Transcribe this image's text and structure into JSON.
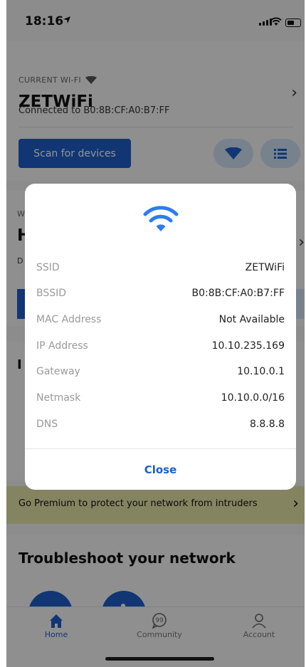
{
  "status_bar": {
    "time": "18:16"
  },
  "current_wifi": {
    "section_label": "CURRENT WI-FI",
    "network_name": "ZETWiFi",
    "connected_text": "Connected to B0:8B:CF:A0:B7:FF",
    "scan_button_label": "Scan for devices"
  },
  "background_partial": {
    "second_label_letter": "W",
    "second_name_letter": "H",
    "second_sub_letter": "D",
    "third_letter": "I"
  },
  "dialog": {
    "rows": [
      {
        "label": "SSID",
        "value": "ZETWiFi"
      },
      {
        "label": "BSSID",
        "value": "B0:8B:CF:A0:B7:FF"
      },
      {
        "label": "MAC Address",
        "value": "Not Available"
      },
      {
        "label": "IP Address",
        "value": "10.10.235.169"
      },
      {
        "label": "Gateway",
        "value": "10.10.0.1"
      },
      {
        "label": "Netmask",
        "value": "10.10.0.0/16"
      },
      {
        "label": "DNS",
        "value": "8.8.8.8"
      }
    ],
    "close_label": "Close"
  },
  "premium_banner": {
    "text": "Go Premium to protect your network from intruders"
  },
  "troubleshoot": {
    "title": "Troubleshoot your network"
  },
  "tabbar": {
    "tabs": [
      {
        "label": "Home"
      },
      {
        "label": "Community"
      },
      {
        "label": "Account"
      }
    ]
  },
  "colors": {
    "accent": "#1e5ec7",
    "wifi_icon": "#2b7cf6",
    "premium_bg": "#e6e3a8",
    "overlay": "rgba(0,0,0,0.42)"
  }
}
